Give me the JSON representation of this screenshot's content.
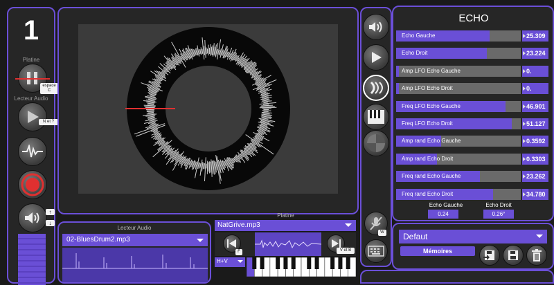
{
  "left": {
    "deck_number": "1",
    "platine_label": "Platine",
    "lecteur_label": "Lecteur Audio",
    "key_space": "espace\nC",
    "key_n": "N et ?",
    "key_up": "↑",
    "key_down": "↓"
  },
  "right_tools": {
    "key_w": "W"
  },
  "echo": {
    "title": "ECHO",
    "params": [
      {
        "label": "Echo Gauche",
        "value": "25.309",
        "fill": 0.75
      },
      {
        "label": "Echo Droit",
        "value": "23.224",
        "fill": 0.73
      },
      {
        "label": "Amp LFO Echo Gauche",
        "value": "0.",
        "fill": 0.02
      },
      {
        "label": "Amp LFO Echo Droit",
        "value": "0.",
        "fill": 0.02
      },
      {
        "label": "Freq LFO Echo Gauche",
        "value": "46.901",
        "fill": 0.88
      },
      {
        "label": "Freq LFO Echo Droit",
        "value": "51.127",
        "fill": 0.93
      },
      {
        "label": "Amp rand Echo Gauche",
        "value": "0.3592",
        "fill": 0.36
      },
      {
        "label": "Amp rand Echo Droit",
        "value": "0.3303",
        "fill": 0.33
      },
      {
        "label": "Freq rand Echo Gauche",
        "value": "23.262",
        "fill": 0.67
      },
      {
        "label": "Freq rand Echo Droit",
        "value": "34.780",
        "fill": 0.78
      }
    ],
    "left_label": "Echo Gauche",
    "left_value": "0.24",
    "right_label": "Echo Droit",
    "right_value": "0.26°"
  },
  "presets": {
    "selected": "Defaut",
    "memories_label": "Mémoires"
  },
  "lecteur": {
    "title": "Lecteur Audio",
    "file": "02-BluesDrum2.mp3"
  },
  "platine": {
    "title": "Platine",
    "file": "NatGrive.mp3",
    "key_f": "F",
    "key_v": "V et B",
    "mode": "H+V"
  },
  "colors": {
    "accent": "#6a4fd6",
    "record": "#e03030"
  }
}
